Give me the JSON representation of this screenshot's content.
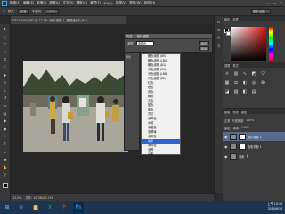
{
  "menubar": {
    "items": [
      "檔案(F)",
      "編輯(E)",
      "影像(I)",
      "圖層(L)",
      "文字(Y)",
      "選取(S)",
      "濾鏡(T)",
      "3D(D)",
      "檢視(V)",
      "視窗(W)",
      "說明(H)"
    ],
    "logo": "Ps"
  },
  "optionsbar": {
    "items": [
      "模式:",
      "正常",
      "不透明:",
      "100%"
    ],
    "workspace": "基本功能",
    "workspace_icon": "dropdown-icon"
  },
  "document": {
    "tab": "DSC04467.JPG @ 12.5% (相片濾鏡 1, 圖層遮色片/8) *"
  },
  "dialog": {
    "title": "內容",
    "subtitle": "相片濾鏡",
    "filter_label": "濾鏡:",
    "filter_value": "深褐色",
    "ok": "確定",
    "cancel": "取消",
    "side_label": "顏色"
  },
  "dropdown": {
    "items": [
      "暖色濾鏡 (85)",
      "暖色濾鏡 (LBA)",
      "暖色濾鏡 (81)",
      "冷色濾鏡 (80)",
      "冷色濾鏡 (LBB)",
      "冷色濾鏡 (82)",
      "紅色",
      "橙色",
      "黃色",
      "綠色",
      "青色",
      "藍色",
      "紫色",
      "洋紅",
      "深褐色",
      "水底",
      "深藍色",
      "翡翠綠",
      "深黃色",
      "水中",
      "深褐色",
      "淺褐",
      "淡紫"
    ],
    "selected_index": 19
  },
  "statusbar": {
    "zoom": "12.5%",
    "info": "文件: 10.3M/25.1M"
  },
  "panels": {
    "tabs": [
      "顏色",
      "色票"
    ],
    "adjust_tabs": [
      "調整",
      "樣式"
    ],
    "layers_tabs": [
      "圖層",
      "色版",
      "路徑"
    ],
    "mode": "正常",
    "opacity_label": "不透明度:",
    "opacity": "100%",
    "lock_label": "鎖定:",
    "fill_label": "填滿:",
    "fill": "100%",
    "layers": [
      {
        "name": "相片濾鏡 1",
        "selected": true
      },
      {
        "name": "色彩平衡 1",
        "selected": false
      },
      {
        "name": "背景",
        "selected": false
      }
    ]
  },
  "taskbar": {
    "time": "上午 10:16",
    "date": "2014/6/18"
  }
}
